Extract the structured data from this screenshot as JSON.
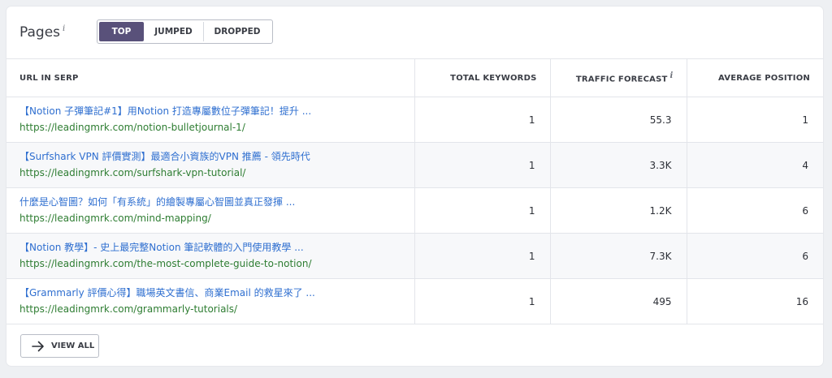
{
  "header": {
    "title": "Pages",
    "title_info": "i",
    "tabs": [
      {
        "label": "TOP",
        "active": true
      },
      {
        "label": "JUMPED",
        "active": false
      },
      {
        "label": "DROPPED",
        "active": false
      }
    ]
  },
  "table": {
    "columns": {
      "url": "URL IN SERP",
      "keywords": "TOTAL KEYWORDS",
      "traffic": "TRAFFIC FORECAST",
      "traffic_info": "i",
      "position": "AVERAGE POSITION"
    },
    "rows": [
      {
        "title": "【Notion 子彈筆記#1】用Notion 打造專屬數位子彈筆記！提升 ...",
        "url": "https://leadingmrk.com/notion-bulletjournal-1/",
        "keywords": "1",
        "traffic": "55.3",
        "position": "1"
      },
      {
        "title": "【Surfshark VPN 評價實測】最適合小資族的VPN 推薦 - 領先時代",
        "url": "https://leadingmrk.com/surfshark-vpn-tutorial/",
        "keywords": "1",
        "traffic": "3.3K",
        "position": "4"
      },
      {
        "title": "什麼是心智圖？如何「有系統」的繪製專屬心智圖並真正發揮 ...",
        "url": "https://leadingmrk.com/mind-mapping/",
        "keywords": "1",
        "traffic": "1.2K",
        "position": "6"
      },
      {
        "title": "【Notion 教學】- 史上最完整Notion 筆記軟體的入門使用教學 ...",
        "url": "https://leadingmrk.com/the-most-complete-guide-to-notion/",
        "keywords": "1",
        "traffic": "7.3K",
        "position": "6"
      },
      {
        "title": "【Grammarly 評價心得】職場英文書信、商業Email 的救星來了 ...",
        "url": "https://leadingmrk.com/grammarly-tutorials/",
        "keywords": "1",
        "traffic": "495",
        "position": "16"
      }
    ]
  },
  "footer": {
    "view_all_label": "VIEW ALL",
    "view_all_icon": "arrow-right-icon"
  },
  "colors": {
    "accent": "#59517a",
    "link": "#2f6fd0",
    "url": "#2e7d32"
  }
}
